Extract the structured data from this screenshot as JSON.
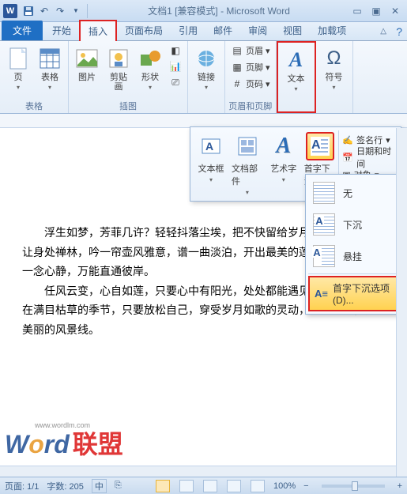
{
  "window": {
    "title": "文档1 [兼容模式] - Microsoft Word"
  },
  "qat": {
    "save": "保存",
    "undo": "撤销",
    "redo": "恢复"
  },
  "tabs": {
    "file": "文件",
    "items": [
      "开始",
      "插入",
      "页面布局",
      "引用",
      "邮件",
      "审阅",
      "视图",
      "加载项"
    ],
    "active_index": 1
  },
  "ribbon": {
    "groups": {
      "tables": {
        "label": "表格",
        "page": "页",
        "table": "表格"
      },
      "illus": {
        "label": "插图",
        "pic": "图片",
        "clip": "剪贴画",
        "shape": "形状"
      },
      "links": {
        "label": " ",
        "link": "链接"
      },
      "hf": {
        "label": "页眉和页脚",
        "header": "页眉",
        "footer": "页脚",
        "pageno": "页码"
      },
      "text": {
        "label": " ",
        "text": "文本"
      },
      "sym": {
        "label": " ",
        "sym": "符号"
      }
    }
  },
  "popup_text": {
    "textbox": "文本框",
    "parts": "文档部件",
    "wordart": "艺术字",
    "dropcap": "首字下沉",
    "sig": "签名行",
    "datetime": "日期和时间",
    "object": "对象"
  },
  "dropcap_menu": {
    "none": "无",
    "dropped": "下沉",
    "margin": "悬挂",
    "options": "首字下沉选项(D)..."
  },
  "document": {
    "p1": "浮生如梦，芳菲几许？轻轻抖落尘埃，把不快留给岁月，寻一处幽境，让身处禅林，吟一帘壶风雅意，谱一曲淡泊，开出最美的莲花。红尘，惟有一念心静，万能直通彼岸。",
    "p2": "任风云变，心自如莲，只要心中有阳光，处处都能遇见春暖花开。纵然在满目枯草的季节，只要放松自己，穿受岁月如歌的灵动，苍茫里也能觅得美丽的风景线。"
  },
  "watermark": {
    "brand": "Word",
    "suffix": "联盟",
    "url": "www.wordlm.com"
  },
  "status": {
    "page": "页面: 1/1",
    "words": "字数: 205",
    "lang": "中",
    "zoom": "100%"
  }
}
